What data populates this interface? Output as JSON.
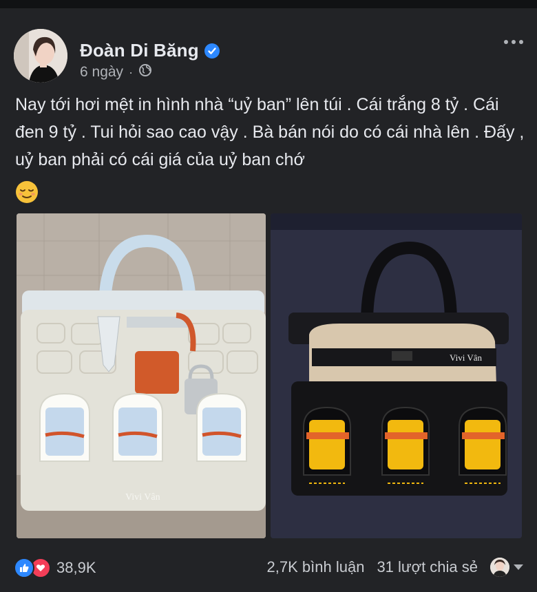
{
  "post": {
    "author": "Đoàn Di Băng",
    "time": "6 ngày",
    "separator": "·",
    "text": "Nay tới hơi mệt in hình nhà “uỷ ban” lên túi . Cái trắng 8 tỷ . Cái đen 9 tỷ . Tui hỏi sao cao vậy . Bà bán nói do có cái nhà lên . Đấy , uỷ ban phải có cái giá của uỷ ban chớ",
    "emoji": "relieved-face",
    "images": [
      {
        "watermark": "Vivi Vân"
      },
      {
        "watermark": "Vivi Vân"
      }
    ]
  },
  "footer": {
    "reaction_count": "38,9K",
    "comments": "2,7K bình luận",
    "shares": "31 lượt chia sẻ"
  },
  "colors": {
    "background": "#222326",
    "verified": "#2d88ff",
    "like": "#2d88ff",
    "love": "#f33e58"
  }
}
